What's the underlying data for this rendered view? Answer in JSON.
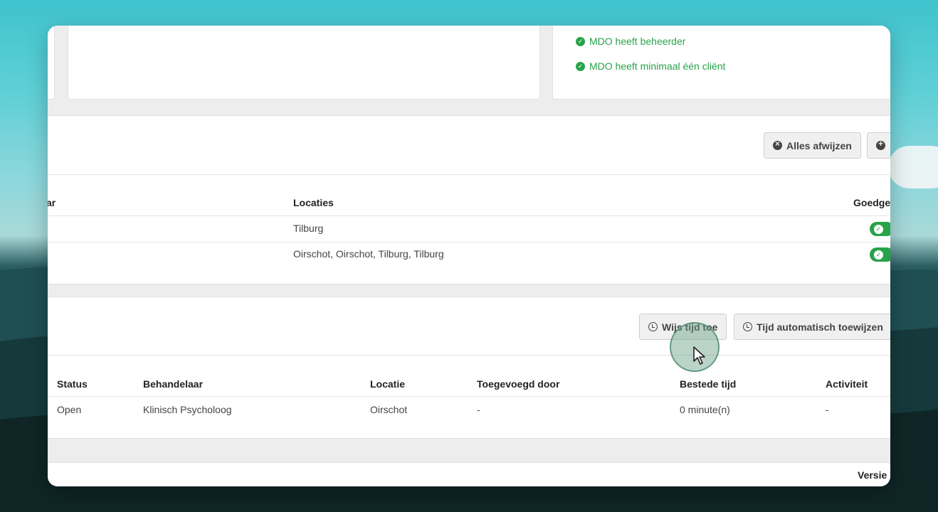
{
  "checks": [
    {
      "label": "MDO heeft beheerder"
    },
    {
      "label": "MDO heeft minimaal één cliënt"
    }
  ],
  "section1": {
    "buttons": {
      "reject_all": "Alles afwijzen"
    },
    "columns": {
      "partial_left": "ar",
      "locations": "Locaties",
      "approved_partial": "Goedge"
    },
    "rows": [
      {
        "locations": "Tilburg"
      },
      {
        "locations": "Oirschot, Oirschot, Tilburg, Tilburg"
      }
    ]
  },
  "section2": {
    "buttons": {
      "assign_time": "Wijs tijd toe",
      "auto_assign_time": "Tijd automatisch toewijzen"
    },
    "columns": {
      "status": "Status",
      "practitioner": "Behandelaar",
      "location": "Locatie",
      "added_by": "Toegevoegd door",
      "time_spent": "Bestede tijd",
      "activity": "Activiteit"
    },
    "rows": [
      {
        "status": "Open",
        "practitioner": "Klinisch Psycholoog",
        "location": "Oirschot",
        "added_by": "-",
        "time_spent": "0 minute(n)",
        "activity": "-"
      }
    ]
  },
  "footer": {
    "version_label": "Versie"
  },
  "colors": {
    "success": "#27a34a",
    "background": "#ededed"
  },
  "icons": {
    "check": "check-circle-icon",
    "reject": "x-circle-icon",
    "add": "plus-circle-icon",
    "clock": "clock-icon",
    "cursor": "mouse-pointer-icon"
  }
}
